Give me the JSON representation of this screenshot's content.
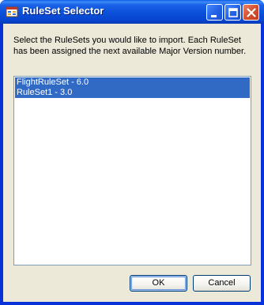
{
  "window": {
    "title": "RuleSet Selector",
    "buttons": [
      "minimize",
      "maximize",
      "close"
    ]
  },
  "instructions": {
    "line1": "Select the RuleSets you would like to import.  Each RuleSet",
    "line2": "has been assigned the next available Major Version number."
  },
  "rulesets": {
    "items": [
      {
        "label": "FlightRuleSet - 6.0",
        "selected": true
      },
      {
        "label": "RuleSet1 - 3.0",
        "selected": true
      }
    ]
  },
  "actions": {
    "ok_label": "OK",
    "cancel_label": "Cancel"
  },
  "colors": {
    "titlebar": "#0a4fd9",
    "dialog_face": "#ece9d8",
    "selection": "#316ac5",
    "close_button": "#d6502f"
  }
}
